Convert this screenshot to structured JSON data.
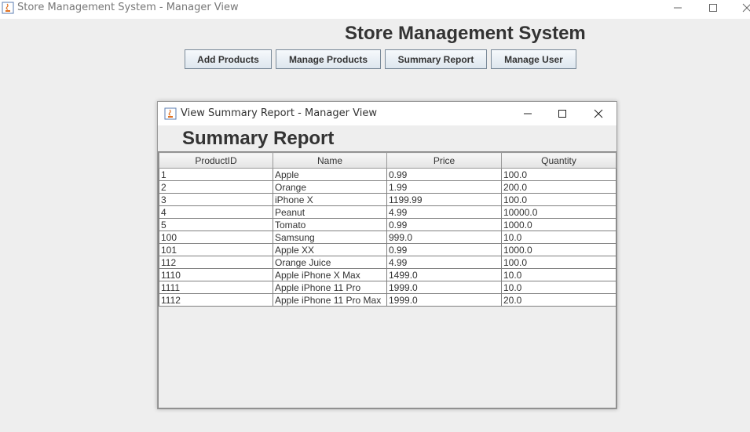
{
  "window": {
    "title": "Store Management System - Manager View",
    "controls": [
      "minimize-icon",
      "maximize-icon",
      "close-icon"
    ]
  },
  "main": {
    "heading": "Store Management System",
    "buttons": [
      {
        "label": "Add Products"
      },
      {
        "label": "Manage Products"
      },
      {
        "label": "Summary Report"
      },
      {
        "label": "Manage User"
      }
    ]
  },
  "report": {
    "title": "View Summary Report - Manager View",
    "heading": "Summary Report",
    "columns": [
      "ProductID",
      "Name",
      "Price",
      "Quantity"
    ],
    "rows": [
      [
        "1",
        "Apple",
        "0.99",
        "100.0"
      ],
      [
        "2",
        "Orange",
        "1.99",
        "200.0"
      ],
      [
        "3",
        "iPhone X",
        "1199.99",
        "100.0"
      ],
      [
        "4",
        "Peanut",
        "4.99",
        "10000.0"
      ],
      [
        "5",
        "Tomato",
        "0.99",
        "1000.0"
      ],
      [
        "100",
        "Samsung",
        "999.0",
        "10.0"
      ],
      [
        "101",
        "Apple XX",
        "0.99",
        "1000.0"
      ],
      [
        "112",
        "Orange Juice",
        "4.99",
        "100.0"
      ],
      [
        "1110",
        "Apple iPhone X Max",
        "1499.0",
        "10.0"
      ],
      [
        "1111",
        "Apple iPhone 11 Pro",
        "1999.0",
        "10.0"
      ],
      [
        "1112",
        "Apple iPhone 11 Pro Max",
        "1999.0",
        "20.0"
      ]
    ]
  },
  "colors": {
    "background": "#eeeeee",
    "button_border": "#7a8a99",
    "text": "#333333"
  }
}
